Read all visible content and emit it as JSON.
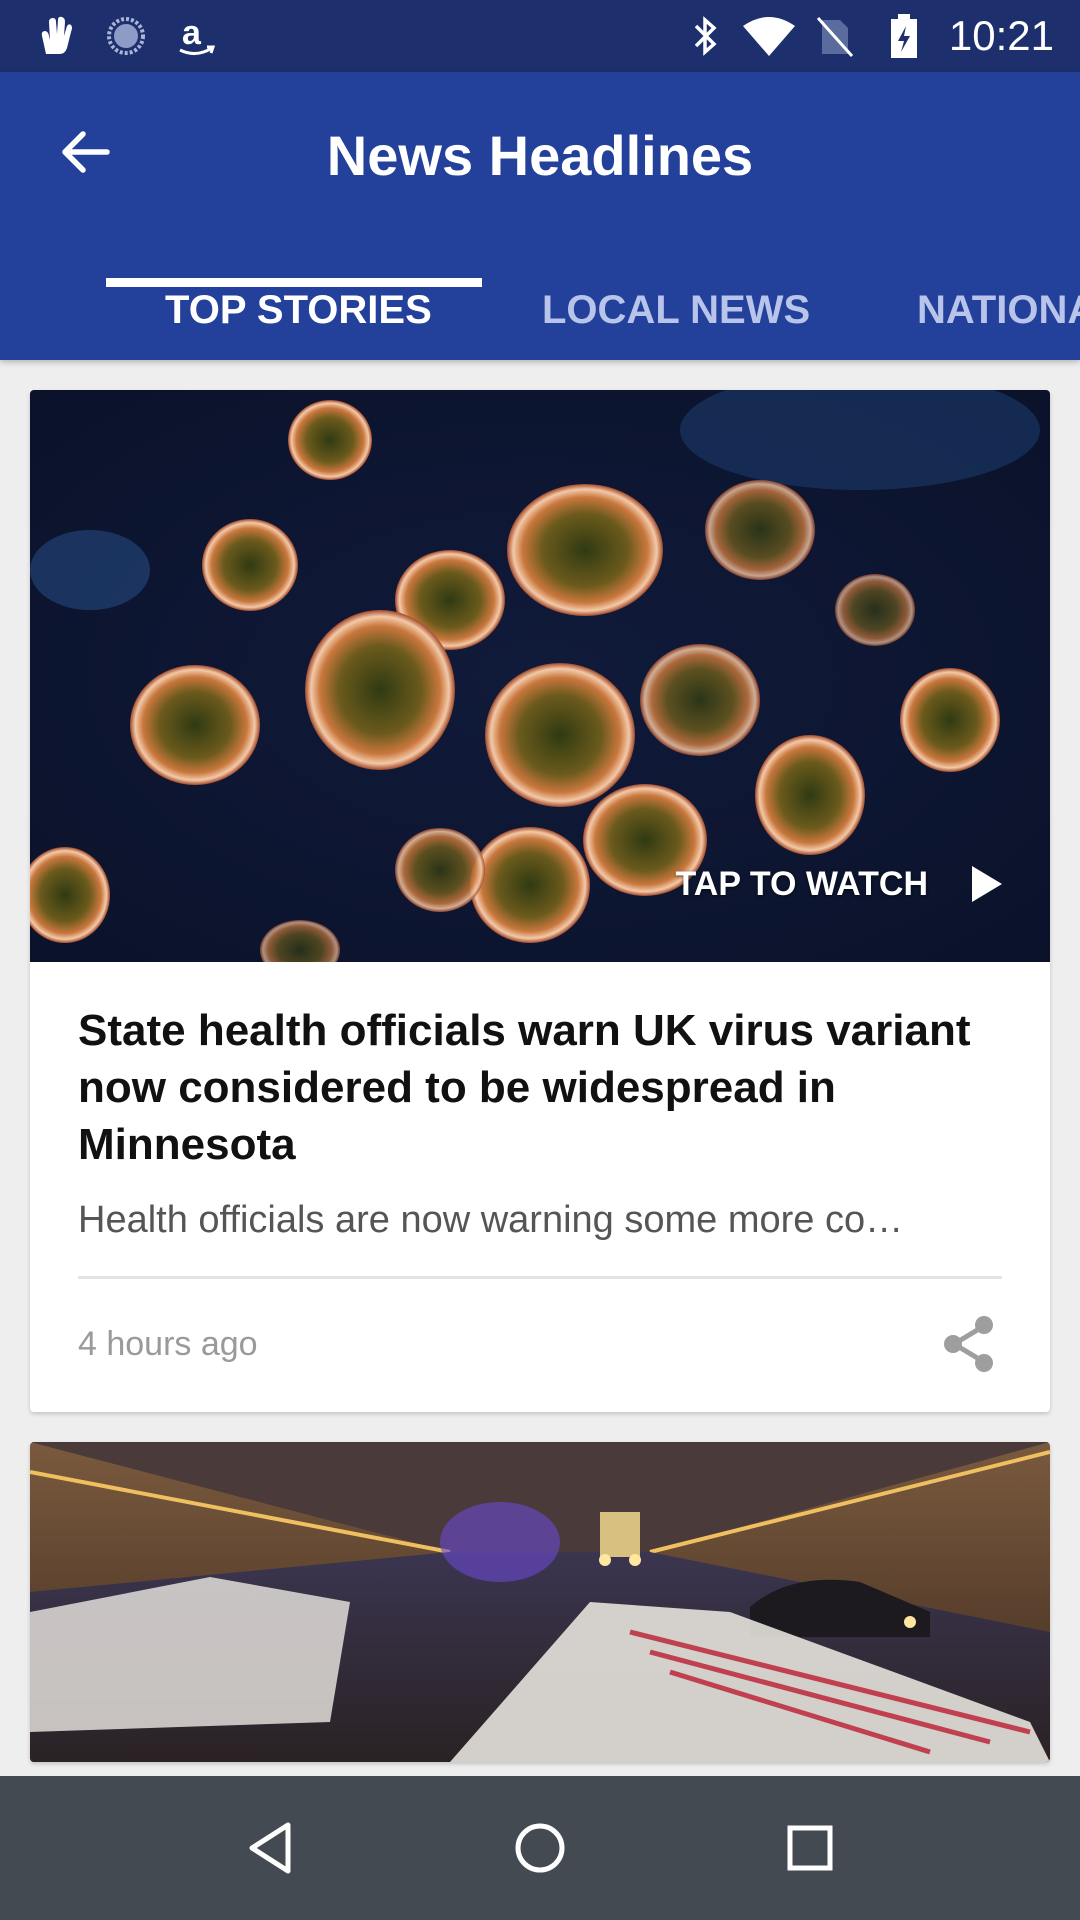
{
  "status_bar": {
    "time": "10:21",
    "left_icons": [
      "hand-icon",
      "loading-icon",
      "amazon-icon"
    ],
    "right_icons": [
      "bluetooth-icon",
      "wifi-icon",
      "no-sim-icon",
      "battery-charging-icon"
    ]
  },
  "app_bar": {
    "title": "News Headlines",
    "back_icon": "arrow-left-icon",
    "background": "#23409b"
  },
  "tabs": [
    {
      "label": "TOP STORIES",
      "active": true
    },
    {
      "label": "LOCAL NEWS",
      "active": false
    },
    {
      "label": "NATIONAL",
      "active": false
    }
  ],
  "articles": [
    {
      "image": "virus-particles-image",
      "video_label": "TAP TO WATCH",
      "headline": "State health officials warn UK virus variant now considered to be widespread in Minnesota",
      "summary": "Health officials are now warning some more co…",
      "time": "4 hours ago"
    },
    {
      "image": "tunnel-debris-image"
    }
  ],
  "nav_bar": {
    "buttons": [
      "back-triangle-icon",
      "home-circle-icon",
      "recents-square-icon"
    ]
  }
}
